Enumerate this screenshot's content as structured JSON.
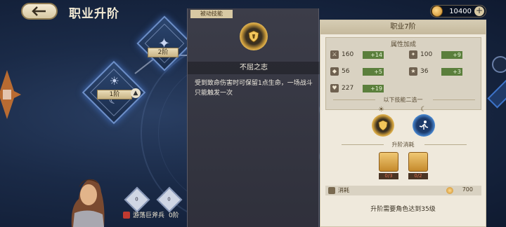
{
  "header": {
    "title": "职业升阶",
    "currency": {
      "amount": "10400",
      "plus": "+"
    }
  },
  "tiers": [
    {
      "label": "1阶"
    },
    {
      "label": "2阶"
    }
  ],
  "hero": {
    "name": "游荡巨斧兵",
    "tier": "0阶"
  },
  "mini_slots": [
    "0",
    "0"
  ],
  "skill": {
    "tag": "被动技能",
    "name": "不屈之志",
    "description": "受到致命伤害时可保留1点生命，一场战斗只能触发一次"
  },
  "rank_panel": {
    "title": "职业7阶",
    "attributes_title": "属性加成",
    "attributes": [
      {
        "icon": "sword",
        "value": "160",
        "inc": "+14"
      },
      {
        "icon": "boot",
        "value": "100",
        "inc": "+9"
      },
      {
        "icon": "shield",
        "value": "56",
        "inc": "+5"
      },
      {
        "icon": "magic",
        "value": "36",
        "inc": "+3"
      },
      {
        "icon": "heart",
        "value": "227",
        "inc": "+19"
      }
    ],
    "choose_title": "以下技能二选一",
    "cost_title": "升阶消耗",
    "items": [
      {
        "count": "0/3"
      },
      {
        "count": "0/2"
      }
    ],
    "consume_label": "消耗",
    "consume_value": "700",
    "requirement": "升阶需要角色达到35级"
  },
  "colors": {
    "background": "#1a2a47",
    "panel_dark": "#3c3d49",
    "panel_light": "#efe9dc",
    "accent_gold": "#c99a3a",
    "increase_green": "#5b7f3c"
  }
}
